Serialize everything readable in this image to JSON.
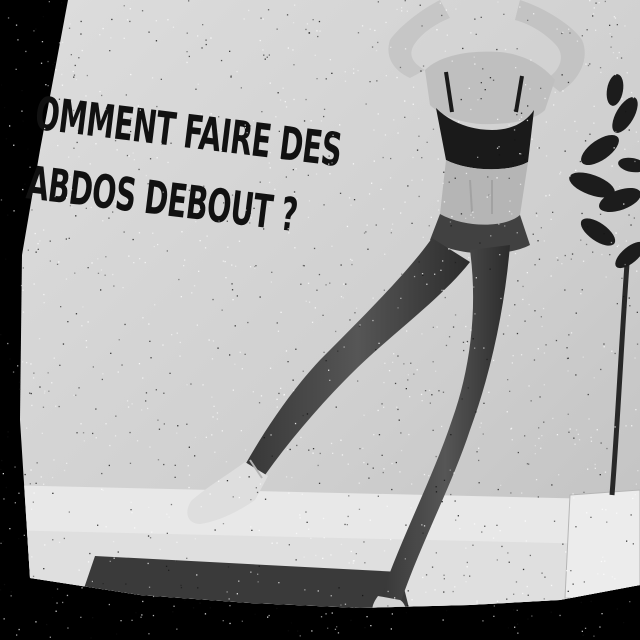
{
  "photo": {
    "headline_line1": "OMMENT FAIRE DES",
    "headline_line2": "ABDOS DEBOUT ?"
  },
  "colors": {
    "background": "#000000",
    "wall": "#dcdcdc",
    "floor": "#efefef",
    "text": "#111111"
  }
}
